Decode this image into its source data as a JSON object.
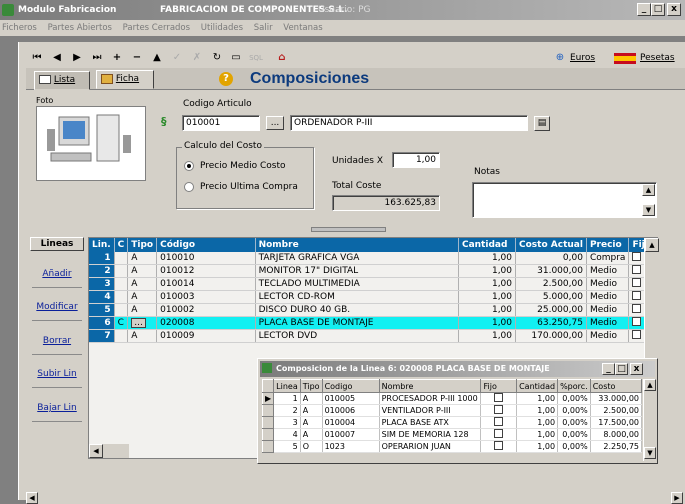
{
  "app": {
    "title": "Modulo Fabricacion",
    "company": "FABRICACION DE COMPONENTES S.L.",
    "user": "Usuario: PG"
  },
  "window_controls": {
    "min": "_",
    "max": "□",
    "close": "x"
  },
  "menu": [
    "Ficheros",
    "Partes Abiertos",
    "Partes Cerrados",
    "Utilidades",
    "Salir",
    "Ventanas"
  ],
  "toolbar": {
    "sql": "SQL",
    "euros": "Euros",
    "pesetas": "Pesetas"
  },
  "tabs": {
    "lista": "Lista",
    "ficha": "Ficha"
  },
  "header": {
    "title": "Composiciones",
    "help_icon": "?"
  },
  "form": {
    "foto_label": "Foto",
    "codigo_label": "Codigo Articulo",
    "codigo_value": "010001",
    "lookup_btn": "...",
    "descripcion_value": "ORDENADOR P-III",
    "calculo_label": "Calculo del Costo",
    "radio1": "Precio Medio Costo",
    "radio2": "Precio Ultima Compra",
    "unidades_label": "Unidades X",
    "unidades_value": "1,00",
    "total_label": "Total Coste",
    "total_value": "163.625,83",
    "notas_label": "Notas"
  },
  "sidebar": {
    "lineas": "Lineas",
    "anadir": "Añadir",
    "modificar": "Modificar",
    "borrar": "Borrar",
    "subir": "Subir Lin",
    "bajar": "Bajar Lin"
  },
  "grid": {
    "columns": [
      "Lin.",
      "C",
      "Tipo",
      "Código",
      "Nombre",
      "Cantidad",
      "Costo Actual",
      "Precio",
      "Fijo"
    ],
    "rows": [
      {
        "lin": "1",
        "c": "",
        "tipo": "A",
        "codigo": "010010",
        "nombre": "TARJETA GRAFICA VGA",
        "cantidad": "1,00",
        "costo": "0,00",
        "precio": "Compra"
      },
      {
        "lin": "2",
        "c": "",
        "tipo": "A",
        "codigo": "010012",
        "nombre": "MONITOR 17\" DIGITAL",
        "cantidad": "1,00",
        "costo": "31.000,00",
        "precio": "Medio"
      },
      {
        "lin": "3",
        "c": "",
        "tipo": "A",
        "codigo": "010014",
        "nombre": "TECLADO MULTIMEDIA",
        "cantidad": "1,00",
        "costo": "2.500,00",
        "precio": "Medio"
      },
      {
        "lin": "4",
        "c": "",
        "tipo": "A",
        "codigo": "010003",
        "nombre": "LECTOR CD-ROM",
        "cantidad": "1,00",
        "costo": "5.000,00",
        "precio": "Medio"
      },
      {
        "lin": "5",
        "c": "",
        "tipo": "A",
        "codigo": "010002",
        "nombre": "DISCO DURO 40 GB.",
        "cantidad": "1,00",
        "costo": "25.000,00",
        "precio": "Medio"
      },
      {
        "lin": "6",
        "c": "C",
        "tipo": "...",
        "codigo": "020008",
        "nombre": "PLACA BASE DE MONTAJE",
        "cantidad": "1,00",
        "costo": "63.250,75",
        "precio": "Medio"
      },
      {
        "lin": "7",
        "c": "",
        "tipo": "A",
        "codigo": "010009",
        "nombre": "LECTOR DVD",
        "cantidad": "1,00",
        "costo": "170.000,00",
        "precio": "Medio"
      }
    ]
  },
  "subwindow": {
    "title": "Composicion de la Linea 6: 020008 PLACA BASE DE MONTAJE",
    "columns": [
      "Linea",
      "Tipo",
      "Codigo",
      "Nombre",
      "Fijo",
      "Cantidad",
      "%porc.",
      "Costo"
    ],
    "rows": [
      {
        "linea": "1",
        "tipo": "A",
        "codigo": "010005",
        "nombre": "PROCESADOR P-III 1000",
        "cantidad": "1,00",
        "porc": "0,00%",
        "costo": "33.000,00"
      },
      {
        "linea": "2",
        "tipo": "A",
        "codigo": "010006",
        "nombre": "VENTILADOR P-III",
        "cantidad": "1,00",
        "porc": "0,00%",
        "costo": "2.500,00"
      },
      {
        "linea": "3",
        "tipo": "A",
        "codigo": "010004",
        "nombre": "PLACA BASE ATX",
        "cantidad": "1,00",
        "porc": "0,00%",
        "costo": "17.500,00"
      },
      {
        "linea": "4",
        "tipo": "A",
        "codigo": "010007",
        "nombre": "SIM DE MEMORIA 128",
        "cantidad": "1,00",
        "porc": "0,00%",
        "costo": "8.000,00"
      },
      {
        "linea": "5",
        "tipo": "O",
        "codigo": "1023",
        "nombre": "OPERARION JUAN",
        "cantidad": "1,00",
        "porc": "0,00%",
        "costo": "2.250,75"
      }
    ]
  }
}
